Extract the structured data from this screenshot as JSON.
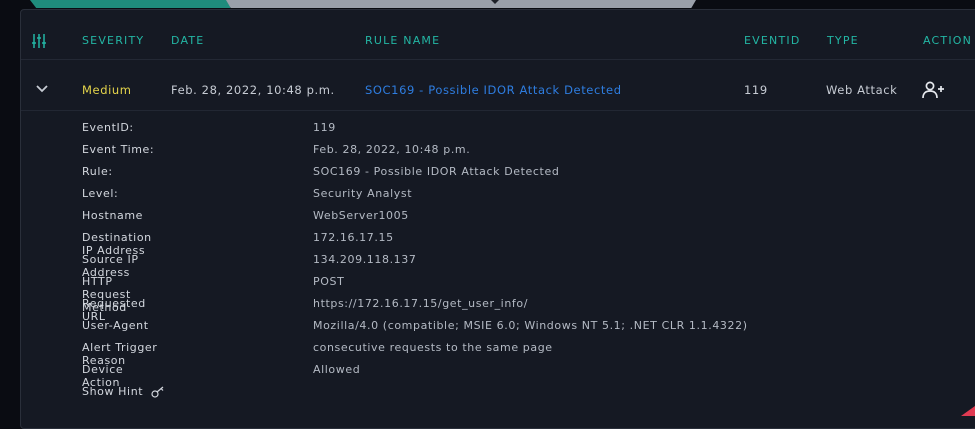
{
  "table": {
    "columns": {
      "severity": "SEVERITY",
      "date": "DATE",
      "rule_name": "RULE NAME",
      "eventid": "EVENTID",
      "type": "TYPE",
      "action": "ACTION"
    },
    "row": {
      "severity": "Medium",
      "date": "Feb. 28, 2022, 10:48 p.m.",
      "rule_name": "SOC169 - Possible IDOR Attack Detected",
      "eventid": "119",
      "type": "Web Attack"
    }
  },
  "details": [
    {
      "label": "EventID:",
      "value": "119"
    },
    {
      "label": "Event Time:",
      "value": "Feb. 28, 2022, 10:48 p.m."
    },
    {
      "label": "Rule:",
      "value": "SOC169 - Possible IDOR Attack Detected"
    },
    {
      "label": "Level:",
      "value": "Security Analyst"
    },
    {
      "label": "Hostname",
      "value": "WebServer1005"
    },
    {
      "label": "Destination IP Address",
      "value": "172.16.17.15"
    },
    {
      "label": "Source IP Address",
      "value": "134.209.118.137"
    },
    {
      "label": "HTTP Request Method",
      "value": "POST"
    },
    {
      "label": "Requested URL",
      "value": "https://172.16.17.15/get_user_info/"
    },
    {
      "label": "User-Agent",
      "value": "Mozilla/4.0 (compatible; MSIE 6.0; Windows NT 5.1; .NET CLR 1.1.4322)"
    },
    {
      "label": "Alert Trigger Reason",
      "value": "consecutive requests to the same page"
    },
    {
      "label": "Device Action",
      "value": "Allowed"
    }
  ],
  "hint": {
    "label": "Show Hint"
  },
  "icons": {
    "filter": "sliders-icon",
    "expand": "chevron-down-icon",
    "assign": "user-plus-icon",
    "hint": "key-icon"
  },
  "colors": {
    "accent_teal": "#23b6a4",
    "severity_medium": "#e4d44b",
    "link_blue": "#2e7de0",
    "panel_bg": "#151923",
    "page_bg": "#0a0c12"
  }
}
